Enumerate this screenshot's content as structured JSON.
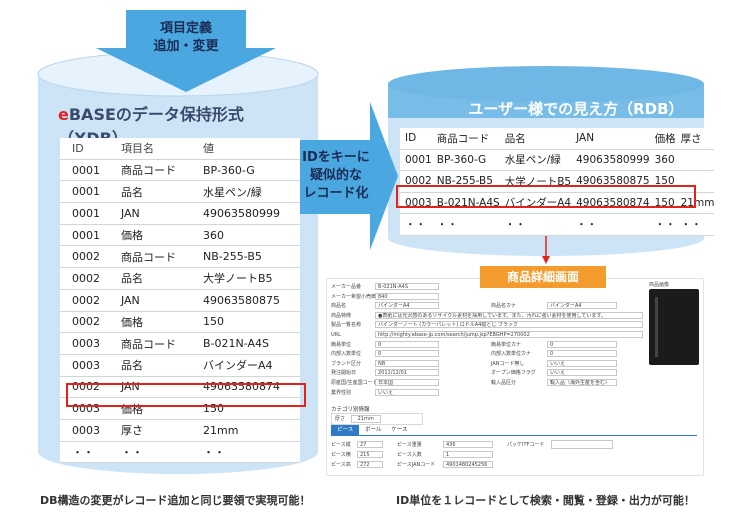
{
  "top_arrow": {
    "line1": "項目定義",
    "line2": "追加・変更"
  },
  "xdb": {
    "title_brand": "e",
    "title_rest": "BASEのデータ保持形式（XDB）",
    "headers": [
      "ID",
      "項目名",
      "値"
    ],
    "rows": [
      [
        "0001",
        "商品コード",
        "BP-360-G"
      ],
      [
        "0001",
        "品名",
        "水星ペン/緑"
      ],
      [
        "0001",
        "JAN",
        "49063580999"
      ],
      [
        "0001",
        "価格",
        "360"
      ],
      [
        "0002",
        "商品コード",
        "NB-255-B5"
      ],
      [
        "0002",
        "品名",
        "大学ノートB5"
      ],
      [
        "0002",
        "JAN",
        "49063580875"
      ],
      [
        "0002",
        "価格",
        "150"
      ],
      [
        "0003",
        "商品コード",
        "B-021N-A4S"
      ],
      [
        "0003",
        "品名",
        "バインダーA4"
      ],
      [
        "0002",
        "JAN",
        "49063580874"
      ],
      [
        "0003",
        "価格",
        "150"
      ],
      [
        "0003",
        "厚さ",
        "21mm"
      ],
      [
        "・・",
        "・・",
        "・・"
      ]
    ]
  },
  "middle_arrow": {
    "line1": "IDをキーに",
    "line2": "疑似的な",
    "line3": "レコード化"
  },
  "rdb": {
    "title": "ユーザー様での見え方（RDB）",
    "headers": [
      "ID",
      "商品コード",
      "品名",
      "JAN",
      "価格",
      "厚さ"
    ],
    "rows": [
      [
        "0001",
        "BP-360-G",
        "水星ペン/緑",
        "49063580999",
        "360",
        ""
      ],
      [
        "0002",
        "NB-255-B5",
        "大学ノートB5",
        "49063580875",
        "150",
        ""
      ],
      [
        "0003",
        "B-021N-A4S",
        "バインダーA4",
        "49063580874",
        "150",
        "21mm"
      ],
      [
        "・・",
        "・・",
        "・・",
        "・・",
        "・・",
        "・・"
      ]
    ]
  },
  "detail": {
    "label": "商品詳細画面",
    "image_label": "商品画像",
    "fields": [
      {
        "label": "メーカー品番",
        "value": "B-021N-A4S"
      },
      {
        "label": "メーカー希望小売価格",
        "value": "840"
      },
      {
        "label": "商品名",
        "value": "バインダーA4"
      },
      {
        "label": "商品特徴",
        "value": "●表紙には光沢感のあるリサイクル素材を採用しています。また、汚れに強い素材を使用しています。"
      },
      {
        "label": "製品一覧名称",
        "value": "バインダーノート (カラーパレット) ロドルA4縦とじ ブラック"
      },
      {
        "label": "URL",
        "value": "http://mighty.ebase-jp.com/search/jump.jsp?EBGHP=270002"
      },
      {
        "label": "簡易単位",
        "value": "0"
      },
      {
        "label": "内部入数単位",
        "value": "0"
      },
      {
        "label": "ブランド区分",
        "value": "NB"
      },
      {
        "label": "発注開始日",
        "value": "2011/12/01"
      },
      {
        "label": "原産国/生産国コード",
        "value": "日本国"
      },
      {
        "label": "業界性別",
        "value": "いいえ"
      }
    ],
    "right_fields": [
      {
        "label": "商品名カナ",
        "value": "バインダーA4"
      },
      {
        "label": "簡易単位カナ",
        "value": "0"
      },
      {
        "label": "内部入数単位カナ",
        "value": "0"
      },
      {
        "label": "JANコード無し",
        "value": "いいえ"
      },
      {
        "label": "オープン価格フラグ",
        "value": "いいえ"
      },
      {
        "label": "輸入品区分",
        "value": "輸入品（海外生産を含む）"
      }
    ],
    "category_label": "カテゴリ別情報",
    "thickness_label": "厚さ",
    "thickness_value": "21mm",
    "tabs": [
      "ピース",
      "ボール",
      "ケース"
    ],
    "piece_rows": [
      {
        "label": "ピース縦",
        "value": "27",
        "label2": "ピース重量",
        "value2": "436"
      },
      {
        "label": "ピース横",
        "value": "215",
        "label2": "ピース入数",
        "value2": "1"
      },
      {
        "label": "ピース高",
        "value": "272",
        "label2": "ピースJANコード",
        "value2": "4901480245256"
      }
    ],
    "pack_label": "パッケITFコード"
  },
  "captions": {
    "left": "DB構造の変更がレコード追加と同じ要領で実現可能！",
    "right": "ID単位を１レコードとして検索・閲覧・登録・出力が可能！"
  },
  "colors": {
    "cylinder": "#cde4f7",
    "cylinder_top": "#e6f2fc",
    "arrow": "#4aa7df",
    "highlight": "#e0241b",
    "detail_label": "#f39c2d"
  }
}
